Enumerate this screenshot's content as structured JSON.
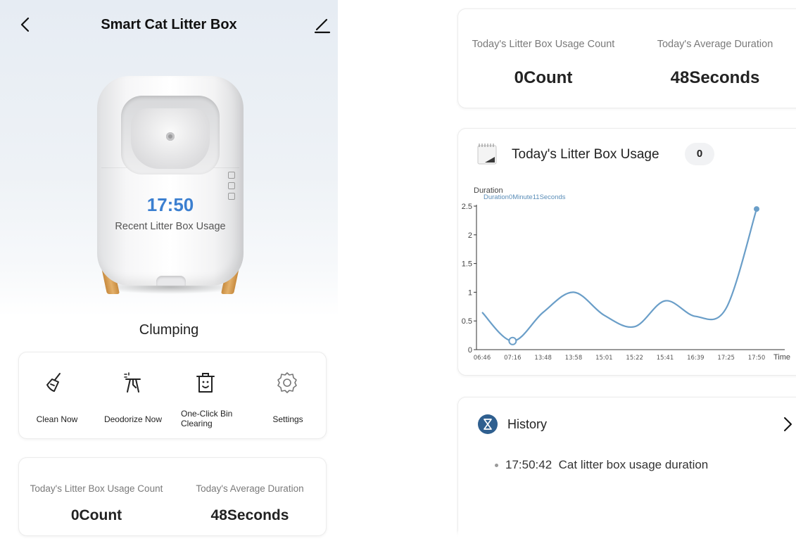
{
  "left": {
    "header": {
      "title": "Smart Cat Litter Box"
    },
    "device": {
      "recent_time": "17:50",
      "recent_label": "Recent Litter Box Usage"
    },
    "status": "Clumping",
    "actions": [
      {
        "label": "Clean Now",
        "icon": "broom-icon"
      },
      {
        "label": "Deodorize Now",
        "icon": "deodorize-icon"
      },
      {
        "label": "One-Click Bin Clearing",
        "icon": "trash-bin-icon"
      },
      {
        "label": "Settings",
        "icon": "gear-icon"
      }
    ],
    "stats": {
      "count_label": "Today's Litter Box Usage Count",
      "count_value": "0Count",
      "avg_label": "Today's Average Duration",
      "avg_value": "48Seconds"
    }
  },
  "right": {
    "stats": {
      "count_label": "Today's Litter Box Usage Count",
      "count_value": "0Count",
      "avg_label": "Today's Average Duration",
      "avg_value": "48Seconds"
    },
    "usage": {
      "title": "Today's Litter Box Usage",
      "count": "0",
      "icon": "calendar-icon"
    },
    "history": {
      "title": "History",
      "icon": "hourglass-icon",
      "items": [
        {
          "time": "17:50:42",
          "text": "Cat litter box usage duration"
        }
      ]
    }
  },
  "colors": {
    "accent_blue": "#3b7fd0",
    "chart_line": "#6a9ec8",
    "history_icon_bg": "#2f5f8f"
  },
  "chart_data": {
    "type": "line",
    "ylabel": "Duration",
    "xlabel": "Time",
    "tooltip": "Duration0Minute11Seconds",
    "categories": [
      "06:46",
      "07:16",
      "13:48",
      "13:58",
      "15:01",
      "15:22",
      "15:41",
      "16:39",
      "17:25",
      "17:50"
    ],
    "values": [
      0.65,
      0.15,
      0.65,
      1.0,
      0.6,
      0.4,
      0.85,
      0.58,
      0.72,
      2.45
    ],
    "yticks": [
      "0",
      "0.5",
      "1",
      "1.5",
      "2",
      "2.5"
    ],
    "ylim": [
      0,
      2.5
    ],
    "highlighted_point": "07:16"
  }
}
